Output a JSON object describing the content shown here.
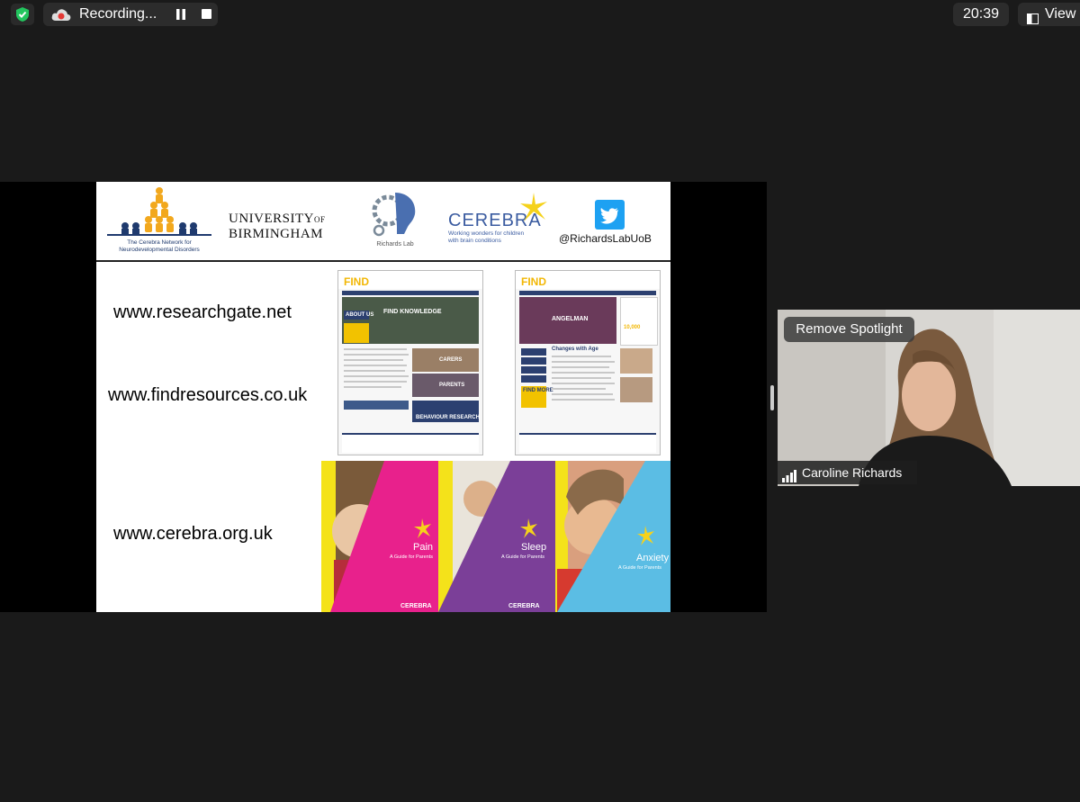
{
  "toolbar": {
    "security_icon": "shield-check-icon",
    "recording_label": "Recording...",
    "recording_icon": "cloud-record-icon",
    "pause_icon": "pause-icon",
    "stop_icon": "stop-icon",
    "clock": "20:39",
    "view_label": "View",
    "view_icon": "view-layout-icon"
  },
  "slide": {
    "logos": {
      "cerebra_network_caption_1": "The Cerebra Network for",
      "cerebra_network_caption_2": "Neurodevelopmental Disorders",
      "university_line1": "UNIVERSITY",
      "university_of": "OF",
      "university_line2": "BIRMINGHAM",
      "richards_lab": "Richards Lab",
      "cerebra_name": "CEREBRA",
      "cerebra_tagline_1": "Working wonders for children",
      "cerebra_tagline_2": "with brain conditions",
      "twitter_handle": "@RichardsLabUoB"
    },
    "urls": [
      "www.researchgate.net",
      "www.findresources.co.uk",
      "www.cerebra.org.uk"
    ],
    "find_sites": {
      "logo": "FIND",
      "hero_left": "FIND KNOWLEDGE",
      "hero_right": "ANGELMAN",
      "about": "ABOUT US",
      "find_more": "FIND MORE",
      "carers": "CARERS",
      "parents": "PARENTS",
      "behaviour": "BEHAVIOUR RESEARCH",
      "changes": "Changes with Age",
      "stat": "10,000"
    },
    "booklets": [
      {
        "title": "Pain",
        "subtitle": "A Guide for Parents",
        "color": "#e8218c"
      },
      {
        "title": "Sleep",
        "subtitle": "A Guide for Parents",
        "color": "#7b3f98"
      },
      {
        "title": "Anxiety",
        "subtitle": "A Guide for Parents",
        "color": "#5bbde4"
      }
    ],
    "booklet_brand": "CEREBRA"
  },
  "participant": {
    "spotlight_button": "Remove Spotlight",
    "name": "Caroline Richards",
    "signal_icon": "signal-bars-icon"
  }
}
